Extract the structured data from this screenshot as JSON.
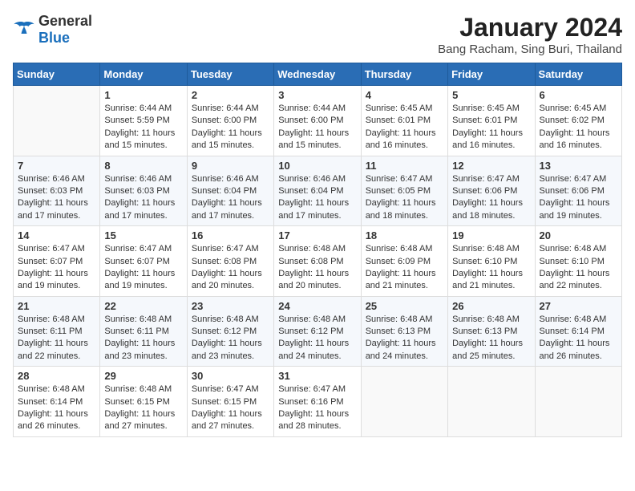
{
  "header": {
    "logo_general": "General",
    "logo_blue": "Blue",
    "title": "January 2024",
    "subtitle": "Bang Racham, Sing Buri, Thailand"
  },
  "weekdays": [
    "Sunday",
    "Monday",
    "Tuesday",
    "Wednesday",
    "Thursday",
    "Friday",
    "Saturday"
  ],
  "weeks": [
    [
      {
        "day": "",
        "sunrise": "",
        "sunset": "",
        "daylight": ""
      },
      {
        "day": "1",
        "sunrise": "Sunrise: 6:44 AM",
        "sunset": "Sunset: 5:59 PM",
        "daylight": "Daylight: 11 hours and 15 minutes."
      },
      {
        "day": "2",
        "sunrise": "Sunrise: 6:44 AM",
        "sunset": "Sunset: 6:00 PM",
        "daylight": "Daylight: 11 hours and 15 minutes."
      },
      {
        "day": "3",
        "sunrise": "Sunrise: 6:44 AM",
        "sunset": "Sunset: 6:00 PM",
        "daylight": "Daylight: 11 hours and 15 minutes."
      },
      {
        "day": "4",
        "sunrise": "Sunrise: 6:45 AM",
        "sunset": "Sunset: 6:01 PM",
        "daylight": "Daylight: 11 hours and 16 minutes."
      },
      {
        "day": "5",
        "sunrise": "Sunrise: 6:45 AM",
        "sunset": "Sunset: 6:01 PM",
        "daylight": "Daylight: 11 hours and 16 minutes."
      },
      {
        "day": "6",
        "sunrise": "Sunrise: 6:45 AM",
        "sunset": "Sunset: 6:02 PM",
        "daylight": "Daylight: 11 hours and 16 minutes."
      }
    ],
    [
      {
        "day": "7",
        "sunrise": "Sunrise: 6:46 AM",
        "sunset": "Sunset: 6:03 PM",
        "daylight": "Daylight: 11 hours and 17 minutes."
      },
      {
        "day": "8",
        "sunrise": "Sunrise: 6:46 AM",
        "sunset": "Sunset: 6:03 PM",
        "daylight": "Daylight: 11 hours and 17 minutes."
      },
      {
        "day": "9",
        "sunrise": "Sunrise: 6:46 AM",
        "sunset": "Sunset: 6:04 PM",
        "daylight": "Daylight: 11 hours and 17 minutes."
      },
      {
        "day": "10",
        "sunrise": "Sunrise: 6:46 AM",
        "sunset": "Sunset: 6:04 PM",
        "daylight": "Daylight: 11 hours and 17 minutes."
      },
      {
        "day": "11",
        "sunrise": "Sunrise: 6:47 AM",
        "sunset": "Sunset: 6:05 PM",
        "daylight": "Daylight: 11 hours and 18 minutes."
      },
      {
        "day": "12",
        "sunrise": "Sunrise: 6:47 AM",
        "sunset": "Sunset: 6:06 PM",
        "daylight": "Daylight: 11 hours and 18 minutes."
      },
      {
        "day": "13",
        "sunrise": "Sunrise: 6:47 AM",
        "sunset": "Sunset: 6:06 PM",
        "daylight": "Daylight: 11 hours and 19 minutes."
      }
    ],
    [
      {
        "day": "14",
        "sunrise": "Sunrise: 6:47 AM",
        "sunset": "Sunset: 6:07 PM",
        "daylight": "Daylight: 11 hours and 19 minutes."
      },
      {
        "day": "15",
        "sunrise": "Sunrise: 6:47 AM",
        "sunset": "Sunset: 6:07 PM",
        "daylight": "Daylight: 11 hours and 19 minutes."
      },
      {
        "day": "16",
        "sunrise": "Sunrise: 6:47 AM",
        "sunset": "Sunset: 6:08 PM",
        "daylight": "Daylight: 11 hours and 20 minutes."
      },
      {
        "day": "17",
        "sunrise": "Sunrise: 6:48 AM",
        "sunset": "Sunset: 6:08 PM",
        "daylight": "Daylight: 11 hours and 20 minutes."
      },
      {
        "day": "18",
        "sunrise": "Sunrise: 6:48 AM",
        "sunset": "Sunset: 6:09 PM",
        "daylight": "Daylight: 11 hours and 21 minutes."
      },
      {
        "day": "19",
        "sunrise": "Sunrise: 6:48 AM",
        "sunset": "Sunset: 6:10 PM",
        "daylight": "Daylight: 11 hours and 21 minutes."
      },
      {
        "day": "20",
        "sunrise": "Sunrise: 6:48 AM",
        "sunset": "Sunset: 6:10 PM",
        "daylight": "Daylight: 11 hours and 22 minutes."
      }
    ],
    [
      {
        "day": "21",
        "sunrise": "Sunrise: 6:48 AM",
        "sunset": "Sunset: 6:11 PM",
        "daylight": "Daylight: 11 hours and 22 minutes."
      },
      {
        "day": "22",
        "sunrise": "Sunrise: 6:48 AM",
        "sunset": "Sunset: 6:11 PM",
        "daylight": "Daylight: 11 hours and 23 minutes."
      },
      {
        "day": "23",
        "sunrise": "Sunrise: 6:48 AM",
        "sunset": "Sunset: 6:12 PM",
        "daylight": "Daylight: 11 hours and 23 minutes."
      },
      {
        "day": "24",
        "sunrise": "Sunrise: 6:48 AM",
        "sunset": "Sunset: 6:12 PM",
        "daylight": "Daylight: 11 hours and 24 minutes."
      },
      {
        "day": "25",
        "sunrise": "Sunrise: 6:48 AM",
        "sunset": "Sunset: 6:13 PM",
        "daylight": "Daylight: 11 hours and 24 minutes."
      },
      {
        "day": "26",
        "sunrise": "Sunrise: 6:48 AM",
        "sunset": "Sunset: 6:13 PM",
        "daylight": "Daylight: 11 hours and 25 minutes."
      },
      {
        "day": "27",
        "sunrise": "Sunrise: 6:48 AM",
        "sunset": "Sunset: 6:14 PM",
        "daylight": "Daylight: 11 hours and 26 minutes."
      }
    ],
    [
      {
        "day": "28",
        "sunrise": "Sunrise: 6:48 AM",
        "sunset": "Sunset: 6:14 PM",
        "daylight": "Daylight: 11 hours and 26 minutes."
      },
      {
        "day": "29",
        "sunrise": "Sunrise: 6:48 AM",
        "sunset": "Sunset: 6:15 PM",
        "daylight": "Daylight: 11 hours and 27 minutes."
      },
      {
        "day": "30",
        "sunrise": "Sunrise: 6:47 AM",
        "sunset": "Sunset: 6:15 PM",
        "daylight": "Daylight: 11 hours and 27 minutes."
      },
      {
        "day": "31",
        "sunrise": "Sunrise: 6:47 AM",
        "sunset": "Sunset: 6:16 PM",
        "daylight": "Daylight: 11 hours and 28 minutes."
      },
      {
        "day": "",
        "sunrise": "",
        "sunset": "",
        "daylight": ""
      },
      {
        "day": "",
        "sunrise": "",
        "sunset": "",
        "daylight": ""
      },
      {
        "day": "",
        "sunrise": "",
        "sunset": "",
        "daylight": ""
      }
    ]
  ]
}
